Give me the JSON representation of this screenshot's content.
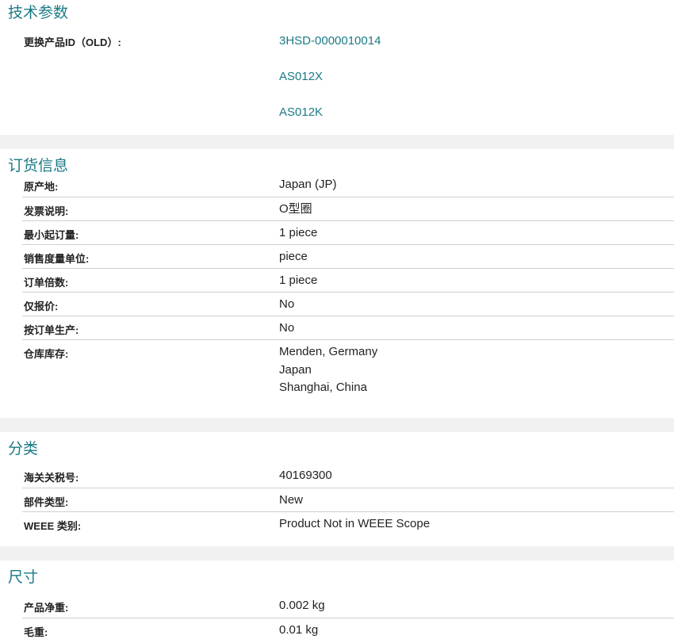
{
  "sections": {
    "tech": {
      "title": "技术参数",
      "replacement_label": "更换产品ID（OLD）:",
      "replacement_ids": [
        "3HSD-0000010014",
        "AS012X",
        "AS012K"
      ]
    },
    "order": {
      "title": "订货信息",
      "rows": [
        {
          "label": "原产地:",
          "value": "Japan (JP)"
        },
        {
          "label": "发票说明:",
          "value": "O型圈"
        },
        {
          "label": "最小起订量:",
          "value": "1 piece"
        },
        {
          "label": "销售度量单位:",
          "value": "piece"
        },
        {
          "label": "订单倍数:",
          "value": "1 piece"
        },
        {
          "label": "仅报价:",
          "value": "No"
        },
        {
          "label": "按订单生产:",
          "value": "No"
        }
      ],
      "warehouse_label": "仓库库存:",
      "warehouse_values": [
        "Menden, Germany",
        "Japan",
        "Shanghai, China"
      ]
    },
    "classification": {
      "title": "分类",
      "rows": [
        {
          "label": "海关关税号:",
          "value": "40169300"
        },
        {
          "label": "部件类型:",
          "value": "New"
        },
        {
          "label": "WEEE 类别:",
          "value": "Product Not in WEEE Scope"
        }
      ]
    },
    "dimensions": {
      "title": "尺寸",
      "rows": [
        {
          "label": "产品净重:",
          "value": "0.002 kg"
        },
        {
          "label": "毛重:",
          "value": "0.01 kg"
        }
      ]
    }
  },
  "colors": {
    "accent": "#1b7a86",
    "separator": "#cfcfcf",
    "gap": "#f1f1f1"
  }
}
